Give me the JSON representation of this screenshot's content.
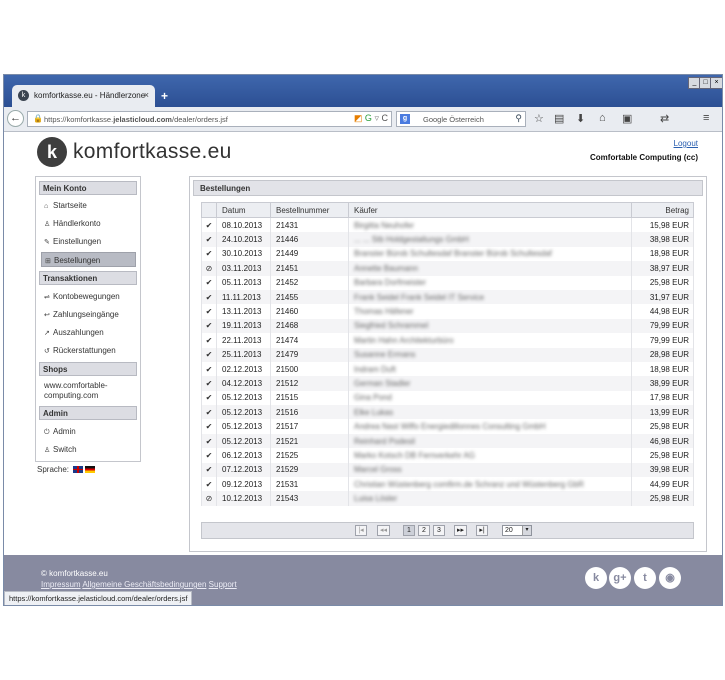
{
  "browser": {
    "tab_title": "komfortkasse.eu - Händlerzone",
    "tab_close": "×",
    "new_tab": "+",
    "url_prefix": "https://komfortkasse.",
    "url_domain": "jelasticloud.com",
    "url_path": "/dealer/orders.jsf",
    "search_placeholder": "Google Österreich",
    "status_url": "https://komfortkasse.jelasticloud.com/dealer/orders.jsf"
  },
  "header": {
    "logo_text": "komfortkasse.eu",
    "logout_label": "Logout",
    "account_name": "Comfortable Computing (cc)"
  },
  "sidebar": {
    "sections": [
      {
        "title": "Mein Konto"
      },
      {
        "title": "Transaktionen"
      },
      {
        "title": "Shops"
      },
      {
        "title": "Admin"
      }
    ],
    "items": [
      {
        "label": "Startseite"
      },
      {
        "label": "Händlerkonto"
      },
      {
        "label": "Einstellungen"
      },
      {
        "label": "Bestellungen"
      },
      {
        "label": "Kontobewegungen"
      },
      {
        "label": "Zahlungseingänge"
      },
      {
        "label": "Auszahlungen"
      },
      {
        "label": "Rückerstattungen"
      },
      {
        "label": "Admin"
      },
      {
        "label": "Switch"
      }
    ],
    "shop_name": "www.comfortable-computing.com",
    "language_label": "Sprache:"
  },
  "orders": {
    "title": "Bestellungen",
    "columns": [
      "Datum",
      "Bestellnummer",
      "Käufer",
      "Betrag"
    ],
    "rows": [
      {
        "status": "✔",
        "date": "08.10.2013",
        "number": "21431",
        "buyer": "Birgitta Neuhofer",
        "amount": "15,98 EUR"
      },
      {
        "status": "✔",
        "date": "24.10.2013",
        "number": "21446",
        "buyer": "... ... Stb Holdgestaltungs GmbH",
        "amount": "38,98 EUR"
      },
      {
        "status": "✔",
        "date": "30.10.2013",
        "number": "21449",
        "buyer": "Branster Bürob Schultesdaf Branster Bürob Schultesdaf",
        "amount": "18,98 EUR"
      },
      {
        "status": "⊘",
        "date": "03.11.2013",
        "number": "21451",
        "buyer": "Annette Baumann",
        "amount": "38,97 EUR"
      },
      {
        "status": "✔",
        "date": "05.11.2013",
        "number": "21452",
        "buyer": "Barbara Dorfmeister",
        "amount": "25,98 EUR"
      },
      {
        "status": "✔",
        "date": "11.11.2013",
        "number": "21455",
        "buyer": "Frank Seidel Frank Seidel IT Service",
        "amount": "31,97 EUR"
      },
      {
        "status": "✔",
        "date": "13.11.2013",
        "number": "21460",
        "buyer": "Thomas Häfener",
        "amount": "44,98 EUR"
      },
      {
        "status": "✔",
        "date": "19.11.2013",
        "number": "21468",
        "buyer": "Siegfried Schrammel",
        "amount": "79,99 EUR"
      },
      {
        "status": "✔",
        "date": "22.11.2013",
        "number": "21474",
        "buyer": "Martin Hahn Architekturbüro",
        "amount": "79,99 EUR"
      },
      {
        "status": "✔",
        "date": "25.11.2013",
        "number": "21479",
        "buyer": "Susanne Ermans",
        "amount": "28,98 EUR"
      },
      {
        "status": "✔",
        "date": "02.12.2013",
        "number": "21500",
        "buyer": "Indram Duft",
        "amount": "18,98 EUR"
      },
      {
        "status": "✔",
        "date": "04.12.2013",
        "number": "21512",
        "buyer": "German Stadler",
        "amount": "38,99 EUR"
      },
      {
        "status": "✔",
        "date": "05.12.2013",
        "number": "21515",
        "buyer": "Gina Pond",
        "amount": "17,98 EUR"
      },
      {
        "status": "✔",
        "date": "05.12.2013",
        "number": "21516",
        "buyer": "Elke Lukas",
        "amount": "13,99 EUR"
      },
      {
        "status": "✔",
        "date": "05.12.2013",
        "number": "21517",
        "buyer": "Andrea Nast Wiffo Energiedillonnes Consulting GmbH",
        "amount": "25,98 EUR"
      },
      {
        "status": "✔",
        "date": "05.12.2013",
        "number": "21521",
        "buyer": "Reinhard Podesil",
        "amount": "46,98 EUR"
      },
      {
        "status": "✔",
        "date": "06.12.2013",
        "number": "21525",
        "buyer": "Marko Kotsch DB Fernverkehr AG",
        "amount": "25,98 EUR"
      },
      {
        "status": "✔",
        "date": "07.12.2013",
        "number": "21529",
        "buyer": "Marcel Gross",
        "amount": "39,98 EUR"
      },
      {
        "status": "✔",
        "date": "09.12.2013",
        "number": "21531",
        "buyer": "Christian Wüstenberg comfirm.de Schranz und Wüstenberg GbR",
        "amount": "44,99 EUR"
      },
      {
        "status": "⊘",
        "date": "10.12.2013",
        "number": "21543",
        "buyer": "Luisa Lösler",
        "amount": "25,98 EUR"
      }
    ],
    "pager": {
      "first": "|◂",
      "prev": "◂◂",
      "pages": [
        "1",
        "2",
        "3"
      ],
      "next": "▸▸",
      "last": "▸|",
      "per_page": "20"
    }
  },
  "footer": {
    "copyright": "© komfortkasse.eu",
    "links": [
      "Impressum",
      "Allgemeine Geschäftsbedingungen",
      "Support"
    ]
  },
  "colors": {
    "titlebar": "#2c4f93",
    "footer": "#878aa0",
    "link": "#2a5fb0"
  }
}
